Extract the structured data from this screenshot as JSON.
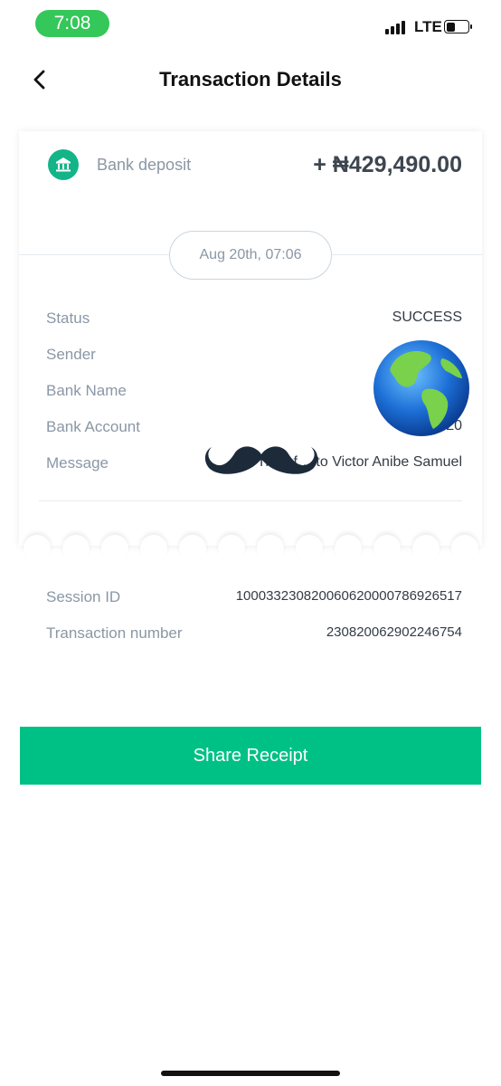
{
  "status_bar": {
    "time": "7:08",
    "network": "LTE",
    "icons": [
      "signal-icon",
      "battery-icon"
    ]
  },
  "nav": {
    "title": "Transaction Details",
    "back_icon": "chevron-left-icon"
  },
  "transaction": {
    "icon": "bank-icon",
    "type_label": "Bank deposit",
    "amount": "+ ₦429,490.00",
    "date": "Aug 20th, 07:06",
    "rows": [
      {
        "label": "Status",
        "value": "SUCCESS"
      },
      {
        "label": "Sender",
        "value": ""
      },
      {
        "label": "Bank Name",
        "value": ""
      },
      {
        "label": "Bank Account",
        "value": "9…20"
      },
      {
        "label": "Message",
        "value": "Transf… to Victor Anibe Samuel"
      }
    ]
  },
  "extra": [
    {
      "label": "Session ID",
      "value": "100033230820060620000786926517"
    },
    {
      "label": "Transaction number",
      "value": "230820062902246754"
    }
  ],
  "share_button": {
    "label": "Share Receipt"
  },
  "colors": {
    "accent": "#00c185",
    "status_pill": "#34c759",
    "label_gray": "#8a97a5"
  }
}
